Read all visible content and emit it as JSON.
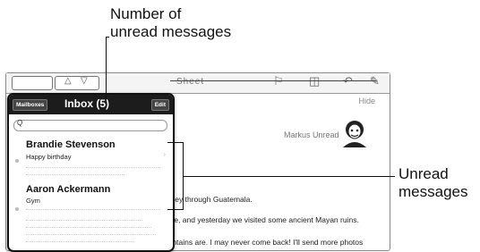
{
  "callouts": {
    "unread_count_line1": "Number of",
    "unread_count_line2": "unread messages",
    "unread_messages_line1": "Unread",
    "unread_messages_line2": "messages"
  },
  "toolbar": {
    "title": "Sheet"
  },
  "mailbox_panel": {
    "mailboxes_label": "Mailboxes",
    "title": "Inbox (5)",
    "edit_label": "Edit",
    "search_icon_glyph": "Q",
    "messages": [
      {
        "sender": "Brandie Stevenson",
        "subject": "Happy birthday",
        "unread": true
      },
      {
        "sender": "Aaron Ackermann",
        "subject": "Gym",
        "unread": true
      }
    ]
  },
  "message_view": {
    "header_right": "Hide",
    "sender_text": "Markus Unread",
    "body_lines": [
      "urney through Guatemala.",
      "ngle, and yesterday we visited some ancient Mayan ruins.",
      "ountains are. I may never come back! I'll send more photos"
    ]
  },
  "colors": {
    "panel_header": "#1c1c1c",
    "callout_line": "#111111"
  }
}
